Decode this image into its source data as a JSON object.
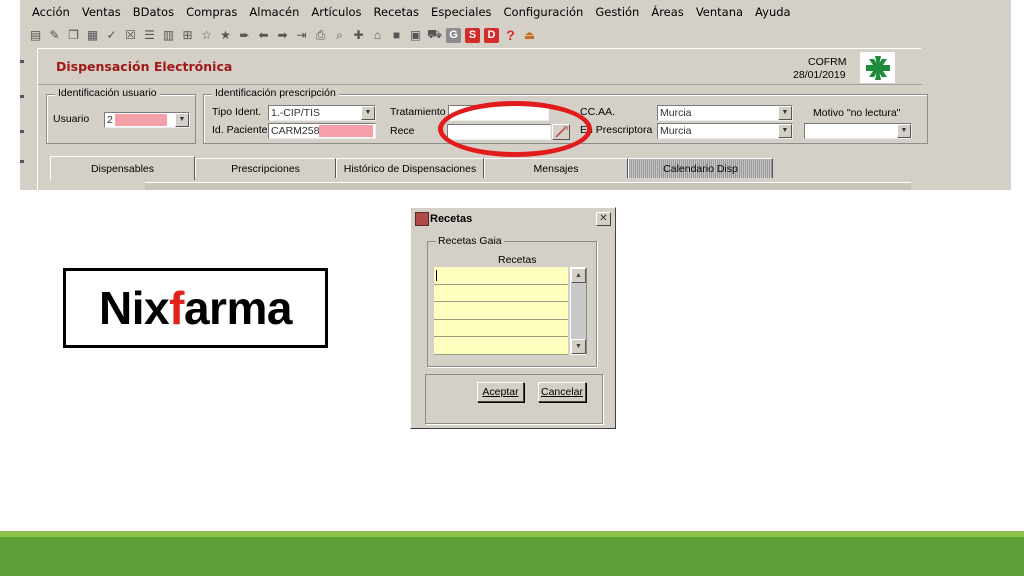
{
  "menu": [
    "Acción",
    "Ventas",
    "BDatos",
    "Compras",
    "Almacén",
    "Artículos",
    "Recetas",
    "Especiales",
    "Configuración",
    "Gestión",
    "Áreas",
    "Ventana",
    "Ayuda"
  ],
  "toolbar": {
    "icons": [
      "save-icon",
      "edit-icon",
      "copy-icon",
      "print-icon",
      "check-icon",
      "close-box-icon",
      "list-icon",
      "filter-icon",
      "tree-icon",
      "star-outline-icon",
      "star-icon",
      "forward-icon",
      "arrow-left-icon",
      "arrow-right-icon",
      "arrow-in-icon",
      "printer-icon",
      "search-icon",
      "pin-icon",
      "home-icon",
      "square-icon",
      "document-icon",
      "cart-icon"
    ],
    "badge_g": "G",
    "badge_s": "S",
    "badge_d": "D",
    "help": "?",
    "badge_colors": {
      "gray": "#8c8c8c",
      "red": "#d42b2b"
    }
  },
  "form": {
    "title": "Dispensación Electrónica",
    "company": "COFRM",
    "date": "28/01/2019",
    "title_color": "#a01818",
    "user_group": {
      "legend": "Identificación usuario",
      "usuario_label": "Usuario",
      "usuario_value": "2"
    },
    "prescription_group": {
      "legend": "Identificación prescripción",
      "tipo_label": "Tipo Ident.",
      "tipo_value": "1.-CIP/TIS",
      "paciente_label": "Id. Paciente",
      "paciente_value": "CARM258",
      "tratamiento_label": "Tratamiento",
      "receta_label": "Rece",
      "ccaa_label": "CC.AA.",
      "ccaa_value": "Murcia",
      "prescriptora_label": "En  Prescriptora",
      "prescriptora_value": "Murcia",
      "motivo_label": "Motivo \"no lectura\""
    },
    "tabs": [
      "Dispensables",
      "Prescripciones",
      "Histórico de Dispensaciones",
      "Mensajes",
      "Calendario Disp"
    ],
    "highlight_color": "#e21c1c"
  },
  "logo": {
    "part1": "Nix",
    "part2": "f",
    "part3": "arma",
    "accent_color": "#e3231b"
  },
  "dialog": {
    "title": "Recetas",
    "close_glyph": "✕",
    "group_legend": "Recetas Gaia",
    "column_header": "Recetas",
    "rows": [
      "",
      "",
      "",
      "",
      ""
    ],
    "accept_label": "Aceptar",
    "cancel_label": "Cancelar",
    "row_color": "#fefebe"
  },
  "footer": {
    "light_green": "#8cc24a",
    "dark_green": "#5e9e36"
  }
}
